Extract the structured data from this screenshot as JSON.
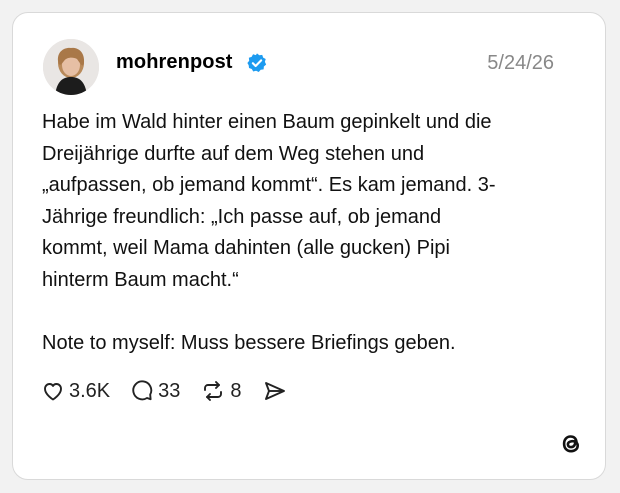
{
  "post": {
    "username": "mohrenpost",
    "verified": true,
    "date": "5/24/26",
    "text": "Habe im Wald hinter einen Baum gepinkelt und die\nDreijährige durfte auf dem Weg stehen und\n„aufpassen, ob jemand kommt“. Es kam jemand. 3-\nJährige freundlich: „Ich passe auf, ob jemand\nkommt, weil Mama dahinten (alle gucken) Pipi\nhinterm Baum macht.“\n\nNote to myself: Muss bessere Briefings geben."
  },
  "actions": {
    "likes": "3.6K",
    "replies": "33",
    "reposts": "8"
  },
  "icons": {
    "like": "heart-icon",
    "reply": "speech-bubble-icon",
    "repost": "repost-icon",
    "share": "send-icon",
    "verified": "verified-badge-icon",
    "brand": "threads-logo-icon"
  },
  "colors": {
    "verified": "#1d9bf0",
    "date": "#888888"
  }
}
